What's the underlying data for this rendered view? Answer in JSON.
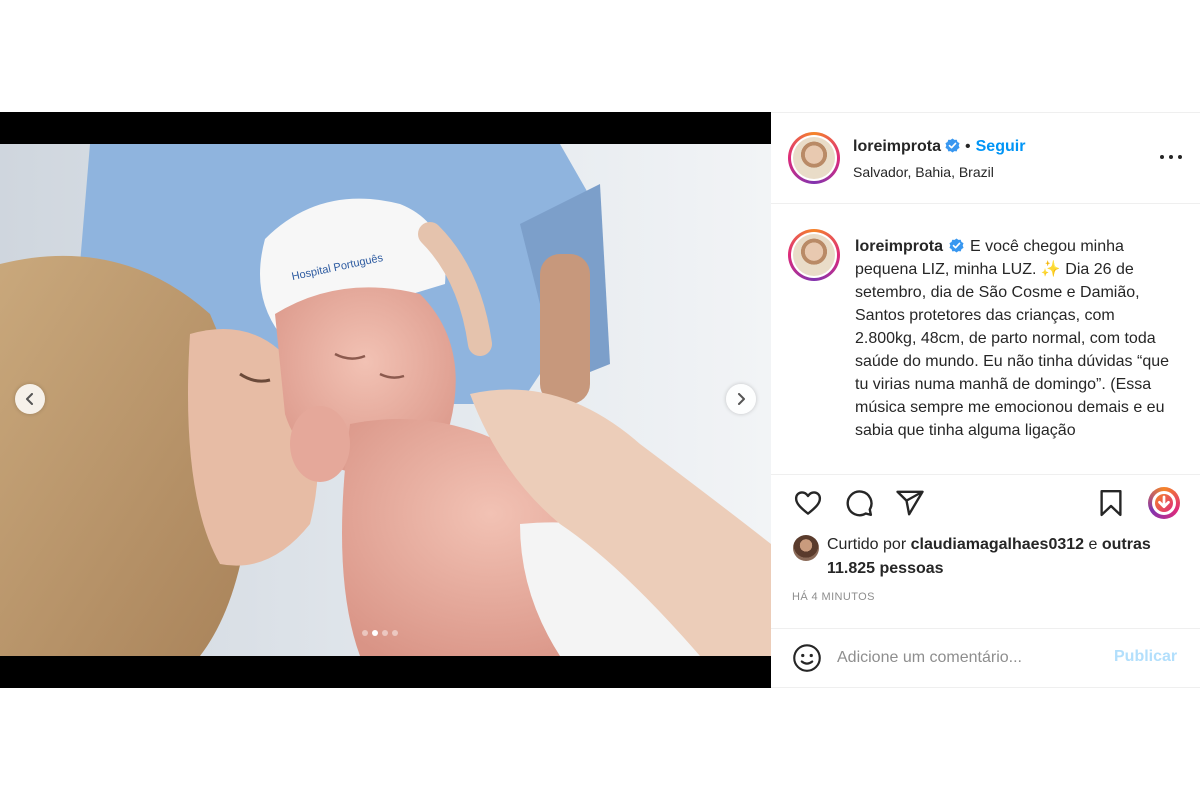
{
  "post": {
    "author": {
      "username": "loreimprota",
      "verified": true,
      "location": "Salvador, Bahia, Brazil",
      "follow_label": "Seguir",
      "separator": "•"
    },
    "caption": {
      "text_before_icon": "E você chegou minha pequena LIZ, minha LUZ.",
      "icon": "sparkles-emoji",
      "icon_glyph": "✨",
      "text_after_icon": "Dia 26 de setembro, dia de São Cosme e Damião, Santos protetores das crianças, com 2.800kg, 48cm, de parto normal, com toda saúde do mundo. Eu não tinha dúvidas “que tu virias numa manhã de domingo”. (Essa música sempre me emocionou demais e eu sabia que tinha alguma ligação"
    },
    "carousel": {
      "total_slides": 4,
      "active_slide": 2
    },
    "likes": {
      "prefix": "Curtido por",
      "liked_by": "claudiamagalhaes0312",
      "joiner": "e",
      "others": "outras 11.825 pessoas"
    },
    "timestamp": "HÁ 4 MINUTOS",
    "comment": {
      "placeholder": "Adicione um comentário...",
      "value": "",
      "submit_label": "Publicar"
    },
    "colors": {
      "follow_blue": "#0095f6",
      "publish_disabled": "#b2dffc",
      "verified_blue": "#3897f0",
      "muted_text": "#8e8e8e"
    },
    "icons": [
      "chevron-left-icon",
      "chevron-right-icon",
      "more-options-icon",
      "verified-badge-icon",
      "heart-icon",
      "comment-icon",
      "share-icon",
      "bookmark-icon",
      "download-icon",
      "emoji-icon"
    ]
  }
}
